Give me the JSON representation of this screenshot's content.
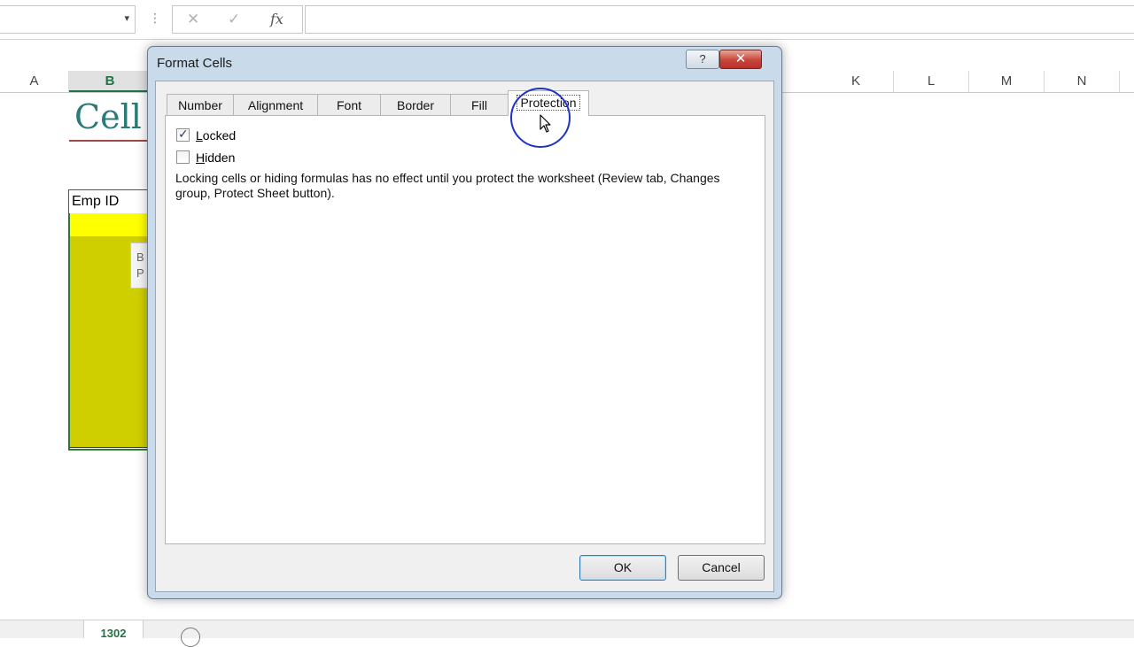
{
  "excel": {
    "formula_bar": {
      "cancel_symbol": "✕",
      "enter_symbol": "✓",
      "fx_symbol": "fx",
      "name_box_arrow": "▾",
      "dots": "⋮"
    },
    "columns": [
      {
        "label": "A"
      },
      {
        "label": "B"
      },
      {
        "label": "K"
      },
      {
        "label": "L"
      },
      {
        "label": "M"
      },
      {
        "label": "N"
      }
    ],
    "sheet_title": "Cell",
    "table_header": "Emp ID",
    "tooltip_lines": [
      "B",
      "P"
    ],
    "sheet_tab": "1302"
  },
  "dialog": {
    "title": "Format Cells",
    "help_symbol": "?",
    "close_symbol": "✕",
    "tabs": [
      {
        "label": "Number"
      },
      {
        "label": "Alignment"
      },
      {
        "label": "Font"
      },
      {
        "label": "Border"
      },
      {
        "label": "Fill"
      },
      {
        "label": "Protection"
      }
    ],
    "active_tab": "Protection",
    "locked": {
      "label_first": "L",
      "label_rest": "ocked",
      "checked": true,
      "mark": "✓"
    },
    "hidden": {
      "label_first": "H",
      "label_rest": "idden",
      "checked": false
    },
    "note": "Locking cells or hiding formulas has no effect until you protect the worksheet (Review tab, Changes group, Protect Sheet button).",
    "ok_label": "OK",
    "cancel_label": "Cancel"
  },
  "colors": {
    "excel_green": "#217346",
    "highlight_circle": "#1f33c7",
    "table_yellow": "#ffff00",
    "table_olive": "#cfcf00"
  }
}
